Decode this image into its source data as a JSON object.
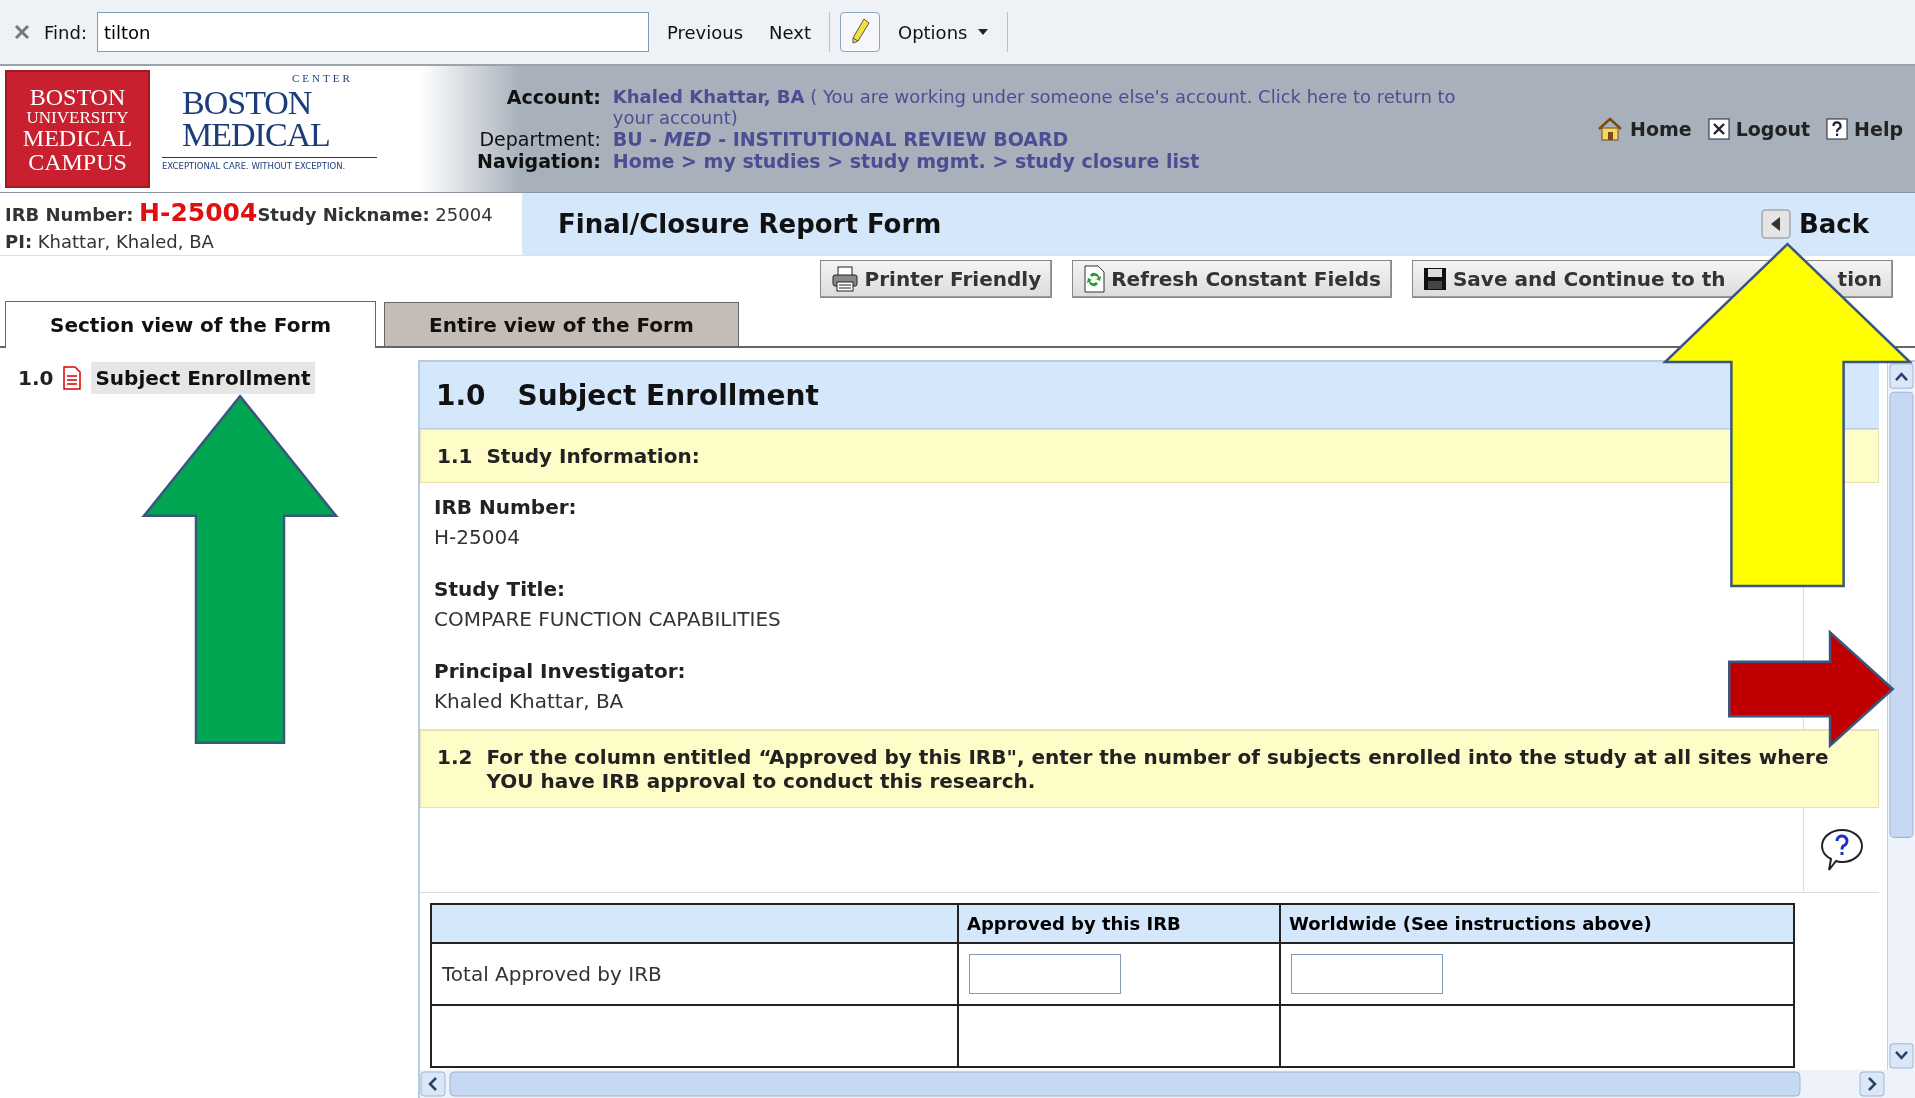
{
  "find_bar": {
    "label": "Find:",
    "value": "tilton",
    "previous": "Previous",
    "next": "Next",
    "options": "Options"
  },
  "header": {
    "university_logo": [
      "BOSTON",
      "UNIVERSITY",
      "MEDICAL",
      "CAMPUS"
    ],
    "medical_logo": {
      "ring": "CENTER",
      "lines": [
        "BOSTON",
        "MEDICAL"
      ],
      "tagline": "EXCEPTIONAL CARE. WITHOUT EXCEPTION."
    },
    "account_label": "Account:",
    "account_name": "Khaled Khattar, BA",
    "account_note": "( You are working under someone else's account. Click here to return to your account)",
    "department_label": "Department:",
    "department": "BU - *MED* - INSTITUTIONAL REVIEW BOARD",
    "navigation_label": "Navigation:",
    "breadcrumb": "Home > my studies > study mgmt. > study closure list",
    "links": [
      {
        "label": "Home",
        "kind": "home"
      },
      {
        "label": "Logout",
        "kind": "logout"
      },
      {
        "label": "Help",
        "kind": "help"
      }
    ]
  },
  "study": {
    "irb_label": "IRB Number:",
    "irb_value": "H-25004",
    "nickname_label": "Study Nickname:",
    "nickname": "25004",
    "pi_label": "PI:",
    "pi": "Khattar, Khaled, BA"
  },
  "form_title": "Final/Closure Report Form",
  "back": "Back",
  "buttons": [
    {
      "label": "Printer Friendly",
      "kind": "print"
    },
    {
      "label": "Refresh Constant Fields",
      "kind": "refresh"
    },
    {
      "label": "Save and Continue to th",
      "label_end": "tion",
      "kind": "save"
    }
  ],
  "tabs": [
    {
      "label": "Section view of the Form",
      "selected": true
    },
    {
      "label": "Entire view of the Form",
      "selected": false
    }
  ],
  "nav": [
    {
      "number": "1.0",
      "label": "Subject Enrollment",
      "selected": true
    }
  ],
  "section": {
    "number": "1.0",
    "title": "Subject Enrollment",
    "subsection_1": {
      "number": "1.1",
      "title": "Study Information:",
      "fields": [
        {
          "label": "IRB Number:",
          "value": "H-25004"
        },
        {
          "label": "Study Title:",
          "value": "COMPARE FUNCTION CAPABILITIES"
        },
        {
          "label": "Principal Investigator:",
          "value": "Khaled Khattar, BA"
        }
      ]
    },
    "subsection_2": {
      "number": "1.2",
      "text": "For the column entitled “Approved by this IRB\", enter the number of subjects enrolled into the study at all sites where YOU have IRB approval to conduct this research."
    },
    "table": {
      "columns": [
        "Approved by this IRB",
        "Worldwide (See instructions above)"
      ],
      "rows": [
        {
          "label": "Total Approved by IRB"
        }
      ]
    }
  },
  "arrows": [
    {
      "kind": "up",
      "color": "#00a651"
    },
    {
      "kind": "up",
      "color": "#ffff00"
    },
    {
      "kind": "right",
      "color": "#c00000"
    }
  ]
}
